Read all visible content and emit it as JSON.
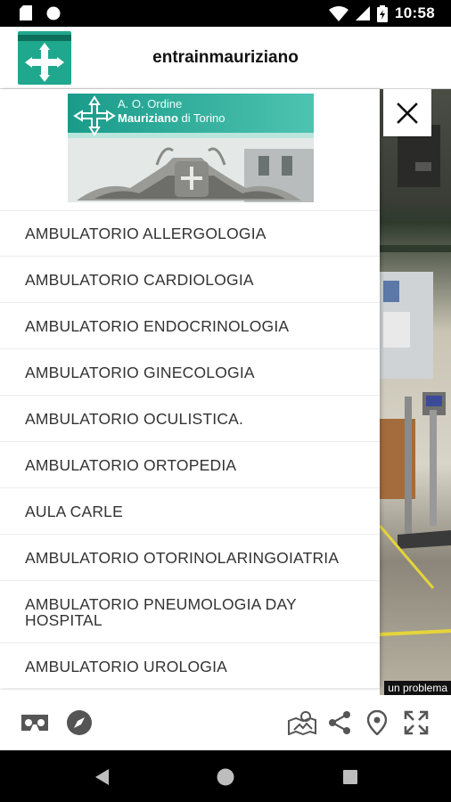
{
  "status_bar": {
    "time": "10:58"
  },
  "app_bar": {
    "title": "entrainmauriziano"
  },
  "logo": {
    "line1": "A. O. Ordine",
    "line2_bold": "Mauriziano",
    "line2_rest": " di Torino"
  },
  "menu": {
    "items": [
      "AMBULATORIO ALLERGOLOGIA",
      "AMBULATORIO CARDIOLOGIA",
      "AMBULATORIO ENDOCRINOLOGIA",
      "AMBULATORIO GINECOLOGIA",
      "AMBULATORIO OCULISTICA.",
      "AMBULATORIO ORTOPEDIA",
      "AULA CARLE",
      "AMBULATORIO OTORINOLARINGOIATRIA",
      "AMBULATORIO PNEUMOLOGIA DAY HOSPITAL",
      "AMBULATORIO UROLOGIA"
    ]
  },
  "panorama": {
    "report_label": "un problema"
  },
  "toolbar": {
    "icons": [
      "vr-headset-icon",
      "compass-icon",
      "map-icon",
      "share-icon",
      "location-pin-icon",
      "fullscreen-icon"
    ]
  },
  "colors": {
    "accent": "#1fa88e",
    "text": "#333333"
  }
}
